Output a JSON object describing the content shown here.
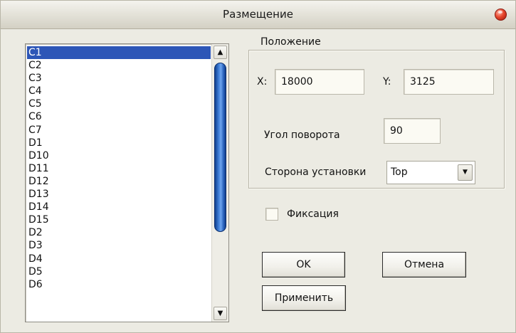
{
  "window": {
    "title": "Размещение",
    "close_icon": "close-icon"
  },
  "list": {
    "items": [
      "C1",
      "C2",
      "C3",
      "C4",
      "C5",
      "C6",
      "C7",
      "D1",
      "D10",
      "D11",
      "D12",
      "D13",
      "D14",
      "D15",
      "D2",
      "D3",
      "D4",
      "D5",
      "D6"
    ],
    "selected": "C1",
    "scroll_up_glyph": "▲",
    "scroll_down_glyph": "▼"
  },
  "position_group": {
    "legend": "Положение",
    "x_label": "X:",
    "x_value": "18000",
    "y_label": "Y:",
    "y_value": "3125",
    "rotation_label": "Угол поворота",
    "rotation_value": "90",
    "side_label": "Сторона установки",
    "side_value": "Top",
    "side_arrow_glyph": "▼"
  },
  "fix": {
    "label": "Фиксация",
    "checked": false
  },
  "buttons": {
    "ok": "OK",
    "cancel": "Отмена",
    "apply": "Применить"
  },
  "colors": {
    "selection": "#2d56b7",
    "close_button": "#e8482e",
    "scroll_thumb": "#3f7fd8"
  }
}
